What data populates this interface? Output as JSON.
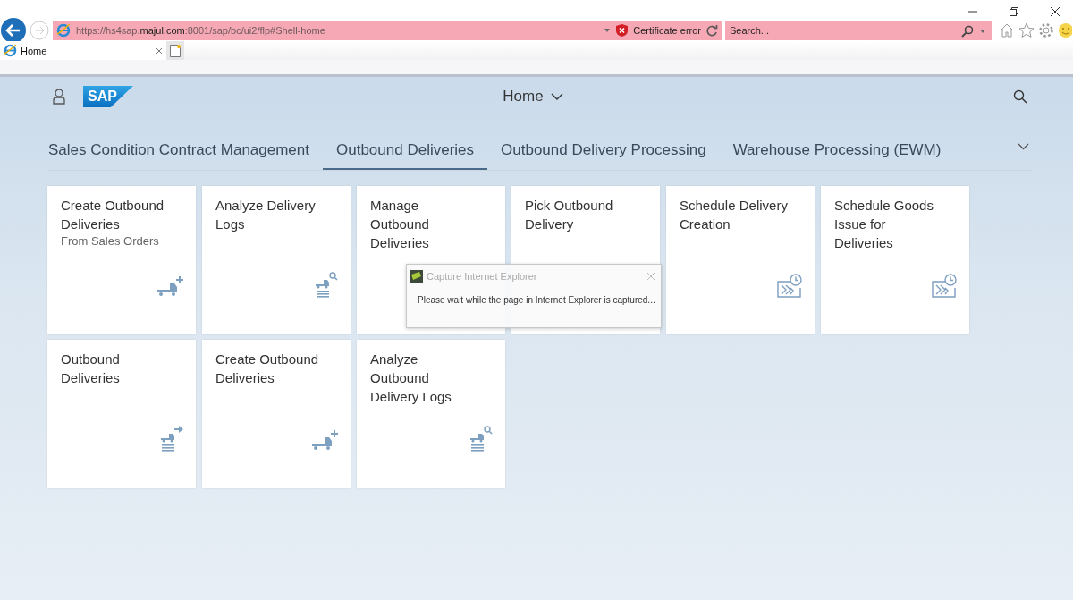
{
  "browser": {
    "url": {
      "prefix": "https://hs4sap.",
      "host": "majul.com",
      "path": ":8001/sap/bc/ui2/flp#Shell-home"
    },
    "certificate": "Certificate error",
    "search": {
      "placeholder": "Search..."
    },
    "tabs": [
      {
        "label": "Home",
        "selected": true
      }
    ]
  },
  "shell": {
    "title": "Home",
    "logo": "SAP"
  },
  "groups": [
    {
      "label": "Sales Condition Contract Management",
      "selected": false
    },
    {
      "label": "Outbound Deliveries",
      "selected": true
    },
    {
      "label": "Outbound Delivery Processing",
      "selected": false
    },
    {
      "label": "Warehouse Processing (EWM)",
      "selected": false
    }
  ],
  "tiles": [
    [
      {
        "title": "Create Outbound Deliveries",
        "subtitle": "From Sales Orders",
        "kind": "create"
      },
      {
        "title": "Analyze Delivery Logs",
        "kind": "analyze"
      },
      {
        "title": "Manage Outbound Deliveries",
        "kind": "covered"
      },
      {
        "title": "Pick Outbound Delivery",
        "kind": "covered"
      },
      {
        "title": "Schedule Delivery Creation",
        "kind": "schedule"
      },
      {
        "title": "Schedule Goods Issue for Deliveries",
        "kind": "schedule"
      }
    ],
    [
      {
        "title": "Outbound Deliveries",
        "kind": "list"
      },
      {
        "title": "Create Outbound Deliveries",
        "kind": "create"
      },
      {
        "title": "Analyze Outbound Delivery Logs",
        "kind": "analyze"
      }
    ]
  ],
  "dialog": {
    "title": "Capture Internet Explorer",
    "message": "Please wait while the page in Internet Explorer is captured..."
  }
}
